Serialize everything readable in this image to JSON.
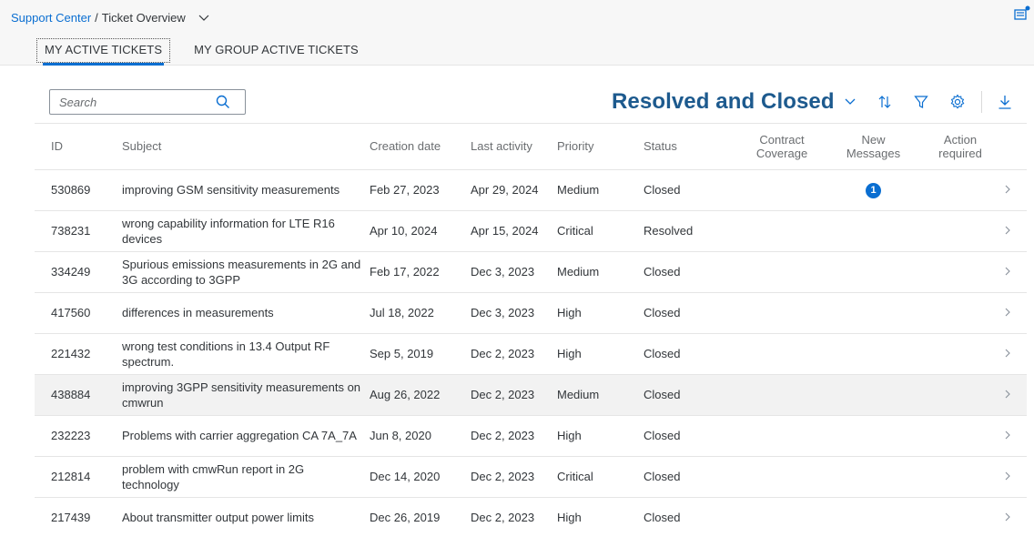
{
  "breadcrumb": {
    "root": "Support Center",
    "separator": "/",
    "current": "Ticket Overview"
  },
  "tabs": [
    {
      "label": "MY ACTIVE TICKETS",
      "active": true
    },
    {
      "label": "MY GROUP ACTIVE TICKETS",
      "active": false
    }
  ],
  "search": {
    "placeholder": "Search",
    "value": ""
  },
  "variant": {
    "label": "Resolved and Closed"
  },
  "icons": {
    "variant_dropdown": "chevron-down-icon",
    "sort": "sort-icon",
    "filter": "filter-icon",
    "settings": "gear-icon",
    "download": "download-icon",
    "row_nav": "chevron-right-icon"
  },
  "colors": {
    "accent": "#0a6ed1",
    "title": "#1d5a8e",
    "highlight_row": "#f2f2f2"
  },
  "table": {
    "columns": {
      "id": "ID",
      "subject": "Subject",
      "creation": "Creation date",
      "last_activity": "Last activity",
      "priority": "Priority",
      "status": "Status",
      "coverage": [
        "Contract",
        "Coverage"
      ],
      "messages": [
        "New",
        "Messages"
      ],
      "action": [
        "Action",
        "required"
      ]
    },
    "rows": [
      {
        "id": "530869",
        "subject": "improving GSM sensitivity measurements",
        "creation": "Feb 27, 2023",
        "last": "Apr 29, 2024",
        "priority": "Medium",
        "status": "Closed",
        "coverage": "",
        "messages": "1",
        "action": ""
      },
      {
        "id": "738231",
        "subject": "wrong capability information for LTE R16 devices",
        "creation": "Apr 10, 2024",
        "last": "Apr 15, 2024",
        "priority": "Critical",
        "status": "Resolved",
        "coverage": "",
        "messages": "",
        "action": ""
      },
      {
        "id": "334249",
        "subject": "Spurious emissions measurements in 2G and 3G according to 3GPP",
        "creation": "Feb 17, 2022",
        "last": "Dec 3, 2023",
        "priority": "Medium",
        "status": "Closed",
        "coverage": "",
        "messages": "",
        "action": ""
      },
      {
        "id": "417560",
        "subject": "differences in measurements",
        "creation": "Jul 18, 2022",
        "last": "Dec 3, 2023",
        "priority": "High",
        "status": "Closed",
        "coverage": "",
        "messages": "",
        "action": ""
      },
      {
        "id": "221432",
        "subject": "wrong test conditions in 13.4 Output RF spectrum.",
        "creation": "Sep 5, 2019",
        "last": "Dec 2, 2023",
        "priority": "High",
        "status": "Closed",
        "coverage": "",
        "messages": "",
        "action": ""
      },
      {
        "id": "438884",
        "subject": "improving 3GPP sensitivity measurements on cmwrun",
        "creation": "Aug 26, 2022",
        "last": "Dec 2, 2023",
        "priority": "Medium",
        "status": "Closed",
        "coverage": "",
        "messages": "",
        "action": "",
        "highlighted": true
      },
      {
        "id": "232223",
        "subject": "Problems with carrier aggregation CA 7A_7A",
        "creation": "Jun 8, 2020",
        "last": "Dec 2, 2023",
        "priority": "High",
        "status": "Closed",
        "coverage": "",
        "messages": "",
        "action": ""
      },
      {
        "id": "212814",
        "subject": "problem with cmwRun report in 2G technology",
        "creation": "Dec 14, 2020",
        "last": "Dec 2, 2023",
        "priority": "Critical",
        "status": "Closed",
        "coverage": "",
        "messages": "",
        "action": ""
      },
      {
        "id": "217439",
        "subject": "About transmitter output power limits",
        "creation": "Dec 26, 2019",
        "last": "Dec 2, 2023",
        "priority": "High",
        "status": "Closed",
        "coverage": "",
        "messages": "",
        "action": ""
      }
    ]
  }
}
